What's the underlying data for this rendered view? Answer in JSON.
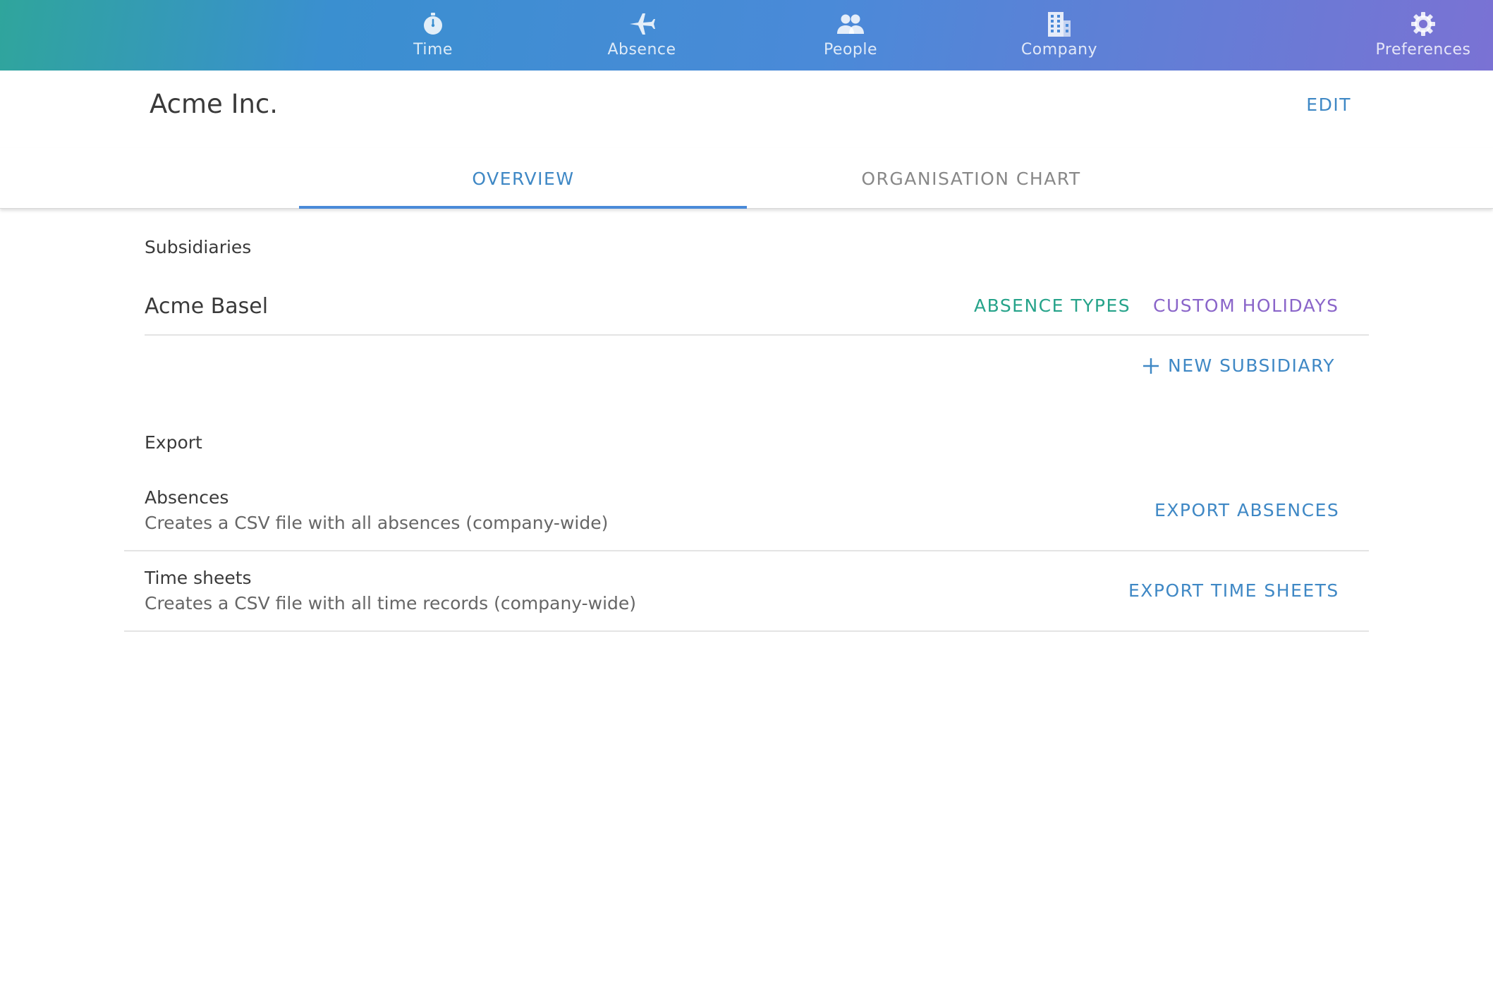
{
  "colors": {
    "accent_blue": "#3f88c5",
    "accent_green": "#26a38a",
    "accent_purple": "#8a65c9"
  },
  "nav": {
    "items": [
      {
        "label": "Time",
        "icon": "stopwatch-icon"
      },
      {
        "label": "Absence",
        "icon": "airplane-icon"
      },
      {
        "label": "People",
        "icon": "people-icon"
      },
      {
        "label": "Company",
        "icon": "building-icon"
      },
      {
        "label": "Preferences",
        "icon": "gear-icon"
      }
    ]
  },
  "header": {
    "title": "Acme Inc.",
    "edit_label": "EDIT"
  },
  "tabs": [
    {
      "label": "OVERVIEW",
      "active": true
    },
    {
      "label": "ORGANISATION CHART",
      "active": false
    }
  ],
  "subsidiaries": {
    "heading": "Subsidiaries",
    "items": [
      {
        "name": "Acme Basel",
        "absence_types_label": "ABSENCE TYPES",
        "custom_holidays_label": "CUSTOM HOLIDAYS"
      }
    ],
    "new_label": "NEW SUBSIDIARY"
  },
  "export": {
    "heading": "Export",
    "rows": [
      {
        "title": "Absences",
        "description": "Creates a CSV file with all absences (company-wide)",
        "action_label": "EXPORT ABSENCES"
      },
      {
        "title": "Time sheets",
        "description": "Creates a CSV file with all time records (company-wide)",
        "action_label": "EXPORT TIME SHEETS"
      }
    ]
  }
}
